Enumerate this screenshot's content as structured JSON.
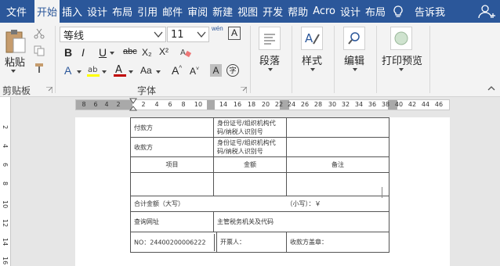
{
  "tabs": [
    "文件",
    "开始",
    "插入",
    "设计",
    "布局",
    "引用",
    "邮件",
    "审阅",
    "新建",
    "视图",
    "开发",
    "帮助",
    "Acro",
    "设计",
    "布局"
  ],
  "active_tab": "开始",
  "tell_me": "告诉我",
  "clipboard": {
    "paste_label": "粘贴",
    "group_label": "剪贴板"
  },
  "font": {
    "name": "等线",
    "size": "11",
    "wen": "wén",
    "A_box": "A",
    "bold": "B",
    "italic": "I",
    "underline": "U",
    "strike": "abc",
    "sub": "X₂",
    "sup": "X²",
    "Aa": "Aa",
    "grow": "A",
    "shrink": "A",
    "shade_A": "A",
    "circle": "字",
    "group_label": "字体"
  },
  "paragraph": {
    "label": "段落"
  },
  "styles": {
    "label": "样式"
  },
  "editing": {
    "label": "编辑"
  },
  "print_preview": {
    "label": "打印预览"
  },
  "ruler": {
    "numbers": [
      "8",
      "6",
      "4",
      "2",
      "2",
      "4",
      "6",
      "8",
      "10",
      "14",
      "16",
      "18",
      "20",
      "22",
      "24",
      "26",
      "28",
      "30",
      "32",
      "34",
      "36",
      "38",
      "40",
      "42",
      "44",
      "46"
    ]
  },
  "vruler": [
    "2",
    "4",
    "6",
    "8",
    "10",
    "12",
    "14",
    "16"
  ],
  "invoice": {
    "payer": "付款方",
    "payer_id": "身份证号/组织机构代码/纳税人识别号",
    "payee": "收款方",
    "payee_id": "身份证号/组织机构代码/纳税人识别号",
    "col_item": "项目",
    "col_amount": "金额",
    "col_note": "备注",
    "total_label": "合计金额（大写）",
    "total_small": "（小写）：￥",
    "query_url": "查询网址",
    "tax_office": "主管税务机关及代码",
    "no": "NO：24400200006222",
    "issuer": "开票人：",
    "seal": "收款方盖章："
  }
}
